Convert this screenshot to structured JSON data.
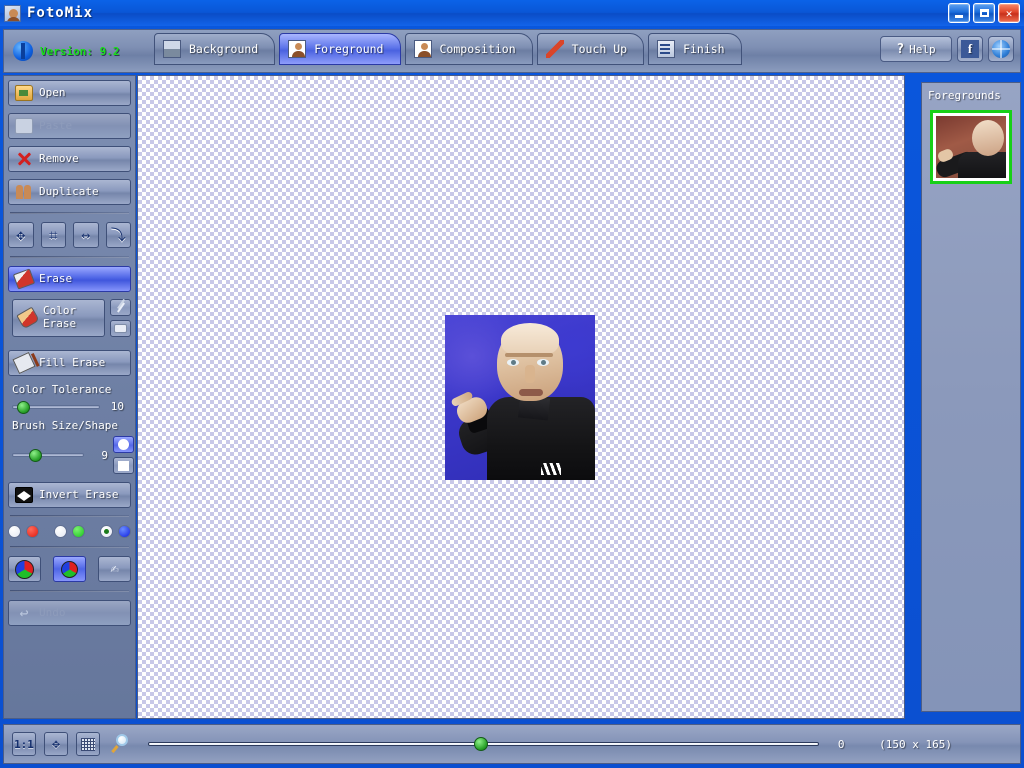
{
  "window": {
    "title": "FotoMix",
    "app_icon": "person-photo-icon",
    "controls": {
      "minimize": "minimize-button",
      "maximize": "maximize-button",
      "close": "close-button"
    }
  },
  "topbar": {
    "version_text": "Version: 9.2",
    "logo": "fotomix-logo-icon",
    "tabs": [
      {
        "label": "Background",
        "icon": "landscape-photo-icon",
        "active": false
      },
      {
        "label": "Foreground",
        "icon": "person-photo-icon",
        "active": true
      },
      {
        "label": "Composition",
        "icon": "composite-photo-icon",
        "active": false
      },
      {
        "label": "Touch Up",
        "icon": "brush-icon",
        "active": false
      },
      {
        "label": "Finish",
        "icon": "save-document-icon",
        "active": false
      }
    ],
    "help_label": "Help",
    "help_icon": "question-mark-icon",
    "facebook_icon": "facebook-icon",
    "facebook_label": "f",
    "web_icon": "globe-icon"
  },
  "sidebar": {
    "buttons": [
      {
        "label": "Open",
        "icon": "folder-open-icon",
        "enabled": true,
        "active": false
      },
      {
        "label": "Paste",
        "icon": "paste-icon",
        "enabled": false,
        "active": false
      },
      {
        "label": "Remove",
        "icon": "red-x-icon",
        "enabled": true,
        "active": false
      },
      {
        "label": "Duplicate",
        "icon": "duplicate-people-icon",
        "enabled": true,
        "active": false
      }
    ],
    "transform_tools": [
      {
        "name": "move-tool",
        "glyph": "✥"
      },
      {
        "name": "crop-tool",
        "glyph": "⌐"
      },
      {
        "name": "flip-horizontal-tool",
        "glyph": "↔"
      },
      {
        "name": "rotate-tool",
        "glyph": "⤵"
      }
    ],
    "erase_tools": [
      {
        "label": "Erase",
        "icon": "eraser-icon",
        "active": true
      },
      {
        "label": "Color Erase",
        "icon": "color-eraser-icon",
        "active": false
      },
      {
        "label": "Fill Erase",
        "icon": "paint-bucket-icon",
        "active": false
      }
    ],
    "eyedropper_icon": "eyedropper-icon",
    "color_swatch_icon": "color-swatch-icon",
    "color_tolerance": {
      "label": "Color Tolerance",
      "value": "10",
      "percent": 8
    },
    "brush": {
      "label": "Brush Size/Shape",
      "value": "9",
      "percent": 22,
      "shapes": [
        {
          "name": "round-brush-shape",
          "selected": true
        },
        {
          "name": "square-brush-shape",
          "selected": false
        }
      ]
    },
    "invert_erase": {
      "label": "Invert Erase",
      "icon": "invert-icon"
    },
    "radio_groups": [
      {
        "options": [
          {
            "color": "white",
            "checked": false
          },
          {
            "color": "red",
            "checked": false
          }
        ]
      },
      {
        "options": [
          {
            "color": "white",
            "checked": false
          },
          {
            "color": "green",
            "checked": false
          }
        ]
      },
      {
        "options": [
          {
            "color": "white",
            "checked": true
          },
          {
            "color": "blue",
            "checked": false
          }
        ]
      }
    ],
    "color_buttons": [
      {
        "name": "color-wheel-large-icon",
        "active": false
      },
      {
        "name": "color-wheel-small-icon",
        "active": true
      },
      {
        "name": "smudge-hand-icon",
        "active": false
      }
    ],
    "undo": {
      "label": "Undo",
      "icon": "undo-arrow-icon",
      "enabled": false
    }
  },
  "canvas": {
    "name": "foreground-canvas",
    "transparency_pattern": "checkerboard",
    "image": {
      "name": "referee-pointing-photo",
      "width": 150,
      "height": 165,
      "background_color": "#3a36c8"
    }
  },
  "right_panel": {
    "title": "Foregrounds",
    "thumbnails": [
      {
        "name": "foreground-thumbnail",
        "selected": true,
        "selection_color": "#17d017"
      }
    ]
  },
  "bottombar": {
    "buttons": [
      {
        "name": "actual-size-button",
        "label": "1:1"
      },
      {
        "name": "fit-to-window-button",
        "label": ""
      },
      {
        "name": "toggle-grid-button",
        "label": ""
      }
    ],
    "magnifier_icon": "magnifier-icon",
    "zoom": {
      "value": "0",
      "percent": 57
    },
    "dimensions": "(150 x 165)"
  }
}
